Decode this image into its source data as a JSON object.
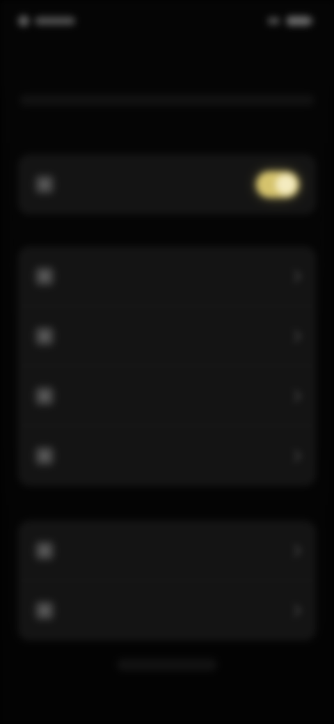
{
  "status_bar": {
    "left_placeholder": "",
    "right_placeholder": ""
  },
  "page": {
    "title": ""
  },
  "sections": [
    {
      "label": "",
      "items": [
        {
          "label": "",
          "icon": "star-icon",
          "has_toggle": true,
          "toggle_state": "on"
        }
      ]
    },
    {
      "label": "",
      "items": [
        {
          "label": "",
          "icon": "user-icon",
          "has_toggle": false
        },
        {
          "label": "",
          "icon": "bolt-icon",
          "has_toggle": false
        },
        {
          "label": "",
          "icon": "lock-icon",
          "has_toggle": false
        },
        {
          "label": "",
          "icon": "info-icon",
          "has_toggle": false
        }
      ]
    },
    {
      "label": "",
      "items": [
        {
          "label": "",
          "icon": "help-icon",
          "has_toggle": false
        },
        {
          "label": "",
          "icon": "chevron-right-icon",
          "has_toggle": false
        }
      ]
    }
  ],
  "colors": {
    "background": "#000000",
    "card": "#141414",
    "accent": "#d5c36d"
  }
}
